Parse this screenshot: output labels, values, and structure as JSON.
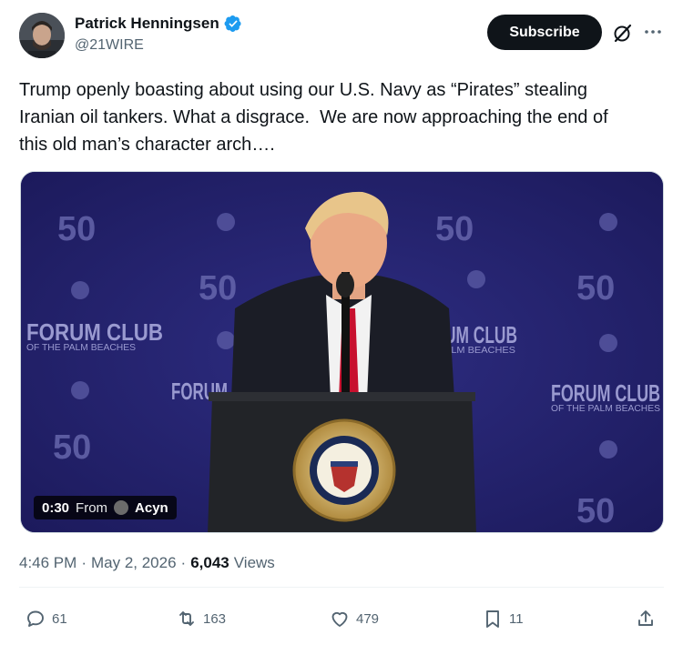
{
  "author": {
    "name": "Patrick Henningsen",
    "handle": "@21WIRE",
    "verified": true
  },
  "header": {
    "subscribe_label": "Subscribe"
  },
  "tweet": {
    "text": "Trump openly boasting about using our U.S. Navy as “Pirates” stealing\nIranian oil tankers. What a disgrace.  We are now approaching the end of\nthis old man’s character arch…."
  },
  "media": {
    "duration": "0:30",
    "from_label": "From",
    "source": "Acyn",
    "backdrop_texts": {
      "forum_club": "FORUM CLUB",
      "palm_beaches": "OF THE PALM BEACHES",
      "forum_partial": "FORUM",
      "um_club": "UM CLUB",
      "palm_partial": "ALM BEACHES",
      "fifty": "50",
      "seal_text": "SEAL OF THE PRESIDENT OF THE UNITED STATES"
    }
  },
  "meta": {
    "time": "4:46 PM",
    "sep1": "·",
    "date": "May 2, 2026",
    "sep2": "·",
    "views_count": "6,043",
    "views_label": "Views"
  },
  "actions": {
    "replies": "61",
    "reposts": "163",
    "likes": "479",
    "bookmarks": "11"
  },
  "colors": {
    "accent_verified": "#1d9bf0",
    "subscribe_bg": "#0f1419",
    "muted_text": "#536471"
  }
}
